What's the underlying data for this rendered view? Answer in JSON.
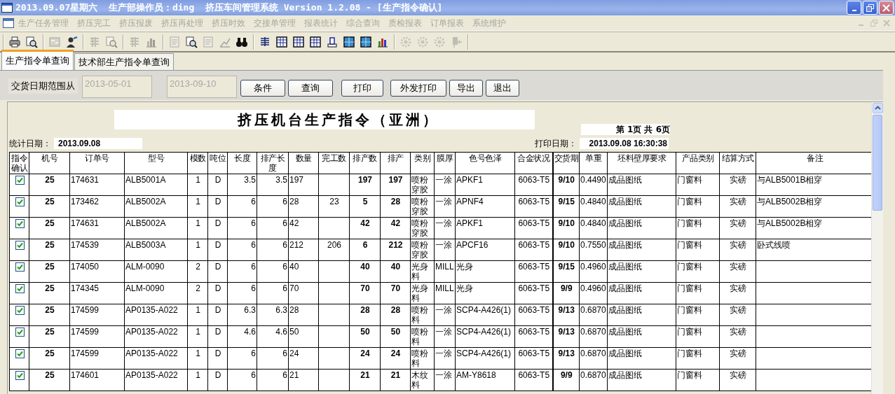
{
  "window": {
    "title": "2013.09.07星期六  生产部操作员：ding  挤压车间管理系统 Version 1.2.08 - [生产指令确认]"
  },
  "menu": [
    {
      "label": "生产任务管理",
      "disabled": true
    },
    {
      "label": "挤压完工",
      "disabled": true
    },
    {
      "label": "挤压报废",
      "disabled": true
    },
    {
      "label": "挤压再处理",
      "disabled": true
    },
    {
      "label": "挤压时效",
      "disabled": true
    },
    {
      "label": "交接单管理",
      "disabled": true
    },
    {
      "label": "报表统计",
      "disabled": true
    },
    {
      "label": "综合查询",
      "disabled": true
    },
    {
      "label": "质检报表",
      "disabled": true
    },
    {
      "label": "订单报表",
      "disabled": true
    },
    {
      "label": "系统维护",
      "disabled": true
    }
  ],
  "toolbar": [
    [
      {
        "disabled": false
      },
      {
        "disabled": false
      }
    ],
    [
      {
        "disabled": true
      },
      {
        "disabled": false
      }
    ],
    [
      {
        "disabled": true
      },
      {
        "disabled": true
      }
    ],
    [
      {
        "disabled": true
      },
      {
        "disabled": true
      }
    ],
    [
      {
        "disabled": true
      },
      {
        "disabled": false
      },
      {
        "disabled": true
      },
      {
        "disabled": true
      },
      {
        "disabled": false
      }
    ],
    [
      {
        "disabled": false
      },
      {
        "disabled": false
      },
      {
        "disabled": false
      },
      {
        "disabled": false
      },
      {
        "disabled": false
      },
      {
        "disabled": false
      },
      {
        "disabled": false
      },
      {
        "disabled": false
      }
    ],
    [
      {
        "disabled": true
      },
      {
        "disabled": true
      },
      {
        "disabled": true
      },
      {
        "disabled": true
      }
    ]
  ],
  "tabs": [
    {
      "label": "生产指令单查询",
      "selected": true
    },
    {
      "label": "技术部生产指令单查询",
      "selected": false
    }
  ],
  "filter": {
    "label": "交货日期范围从",
    "date_from": "2013-05-01",
    "date_to": "2013-09-10",
    "buttons": [
      "条件",
      "查询",
      "打印",
      "外发打印",
      "导出",
      "退出"
    ]
  },
  "report": {
    "title": "挤压机台生产指令（亚洲）",
    "page_info": "第 1页 共 6页",
    "stat_label": "统计日期：",
    "stat_date": "2013.09.08",
    "print_label": "打印日期：",
    "print_date": "2013.09.08 16:30:38",
    "check_column": "指令确认",
    "columns": [
      "机号",
      "订单号",
      "型号",
      "模数",
      "吨位",
      "长度",
      "排产长度",
      "数量",
      "完工数",
      "排产数",
      "排产",
      "类别",
      "膜厚",
      "色号色泽",
      "合金状况",
      "交货期",
      "单重",
      "坯料壁厚要求",
      "产品类别",
      "结算方式",
      "备注"
    ],
    "rows": [
      {
        "confirmed": true,
        "cells": [
          "25",
          "174631",
          "ALB5001A",
          "1",
          "D",
          "3.5",
          "3.5",
          "197",
          null,
          "197",
          "197",
          "喷粉穿胶",
          "一涂",
          "APKF1",
          "6063-T5",
          "9/10",
          "0.4490",
          "成品图纸",
          "门窗料",
          "实磅",
          "与ALB5001B相穿"
        ]
      },
      {
        "confirmed": true,
        "cells": [
          "25",
          "173462",
          "ALB5002A",
          "1",
          "D",
          "6",
          "6",
          "28",
          "23",
          "5",
          "28",
          "喷粉穿胶",
          "一涂",
          "APNF4",
          "6063-T5",
          "9/15",
          "0.4840",
          "成品图纸",
          "门窗料",
          "实磅",
          "与ALB5002B相穿"
        ]
      },
      {
        "confirmed": true,
        "cells": [
          "25",
          "174631",
          "ALB5002A",
          "1",
          "D",
          "6",
          "6",
          "42",
          null,
          "42",
          "42",
          "喷粉穿胶",
          "一涂",
          "APKF1",
          "6063-T5",
          "9/10",
          "0.4840",
          "成品图纸",
          "门窗料",
          "实磅",
          "与ALB5002B相穿"
        ]
      },
      {
        "confirmed": true,
        "cells": [
          "25",
          "174539",
          "ALB5003A",
          "1",
          "D",
          "6",
          "6",
          "212",
          "206",
          "6",
          "212",
          "喷粉穿胶",
          "一涂",
          "APCF16",
          "6063-T5",
          "9/10",
          "0.7550",
          "成品图纸",
          "门窗料",
          "实磅",
          "卧式线喷"
        ]
      },
      {
        "confirmed": true,
        "cells": [
          "25",
          "174050",
          "ALM-0090",
          "2",
          "D",
          "6",
          "6",
          "40",
          null,
          "40",
          "40",
          "光身料",
          "MILL",
          "光身",
          "6063-T5",
          "9/15",
          "0.4960",
          "成品图纸",
          "门窗料",
          "实磅",
          null
        ]
      },
      {
        "confirmed": true,
        "cells": [
          "25",
          "174345",
          "ALM-0090",
          "2",
          "D",
          "6",
          "6",
          "70",
          null,
          "70",
          "70",
          "光身料",
          "MILL",
          "光身",
          "6063-T5",
          "9/9",
          "0.4960",
          "成品图纸",
          "门窗料",
          "实磅",
          null
        ]
      },
      {
        "confirmed": true,
        "cells": [
          "25",
          "174599",
          "AP0135-A022",
          "1",
          "D",
          "6.3",
          "6.3",
          "28",
          null,
          "28",
          "28",
          "喷粉料",
          "一涂",
          "SCP4-A426(1)",
          "6063-T5",
          "9/13",
          "0.6870",
          "成品图纸",
          "门窗料",
          "实磅",
          null
        ]
      },
      {
        "confirmed": true,
        "cells": [
          "25",
          "174599",
          "AP0135-A022",
          "1",
          "D",
          "4.6",
          "4.6",
          "50",
          null,
          "50",
          "50",
          "喷粉料",
          "一涂",
          "SCP4-A426(1)",
          "6063-T5",
          "9/13",
          "0.6870",
          "成品图纸",
          "门窗料",
          "实磅",
          null
        ]
      },
      {
        "confirmed": true,
        "cells": [
          "25",
          "174599",
          "AP0135-A022",
          "1",
          "D",
          "6",
          "6",
          "24",
          null,
          "24",
          "24",
          "喷粉料",
          "一涂",
          "SCP4-A426(1)",
          "6063-T5",
          "9/13",
          "0.6870",
          "成品图纸",
          "门窗料",
          "实磅",
          null
        ]
      },
      {
        "confirmed": true,
        "cells": [
          "25",
          "174601",
          "AP0135-A022",
          "1",
          "D",
          "6",
          "6",
          "21",
          null,
          "21",
          "21",
          "木纹料",
          "一涂",
          "AM-Y8618",
          "6063-T5",
          "9/9",
          "0.6870",
          "成品图纸",
          "门窗料",
          "实磅",
          null
        ]
      }
    ]
  }
}
